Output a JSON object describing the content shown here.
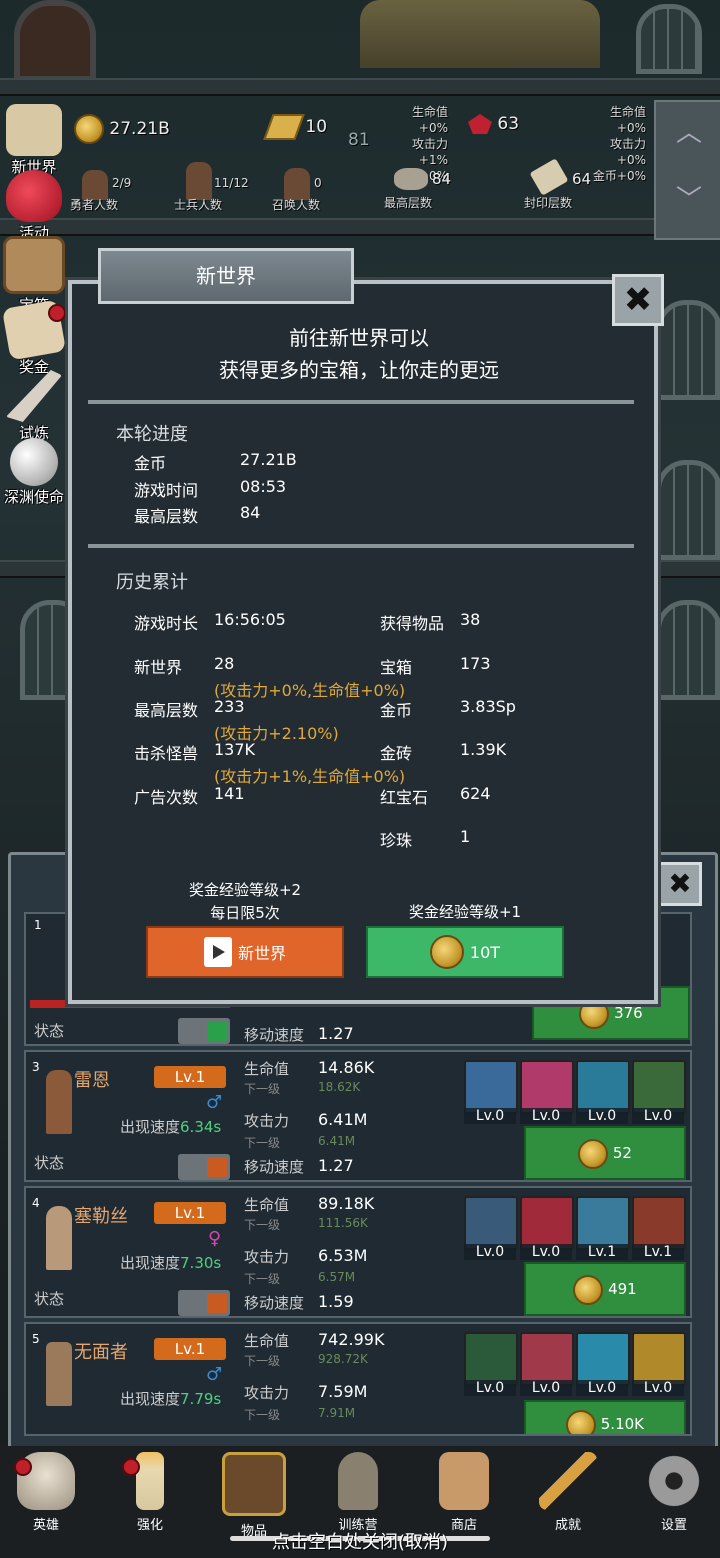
{
  "left_menu": [
    {
      "name": "left-menu-new-world",
      "label": "新世界",
      "icon": "scroll-icon"
    },
    {
      "name": "left-menu-events",
      "label": "活动",
      "icon": "heart-icon"
    },
    {
      "name": "left-menu-chest",
      "label": "宝箱",
      "icon": "chest-icon"
    },
    {
      "name": "left-menu-reward",
      "label": "奖金",
      "icon": "letter-icon"
    },
    {
      "name": "left-menu-trial",
      "label": "试炼",
      "icon": "feather-icon"
    },
    {
      "name": "left-menu-abyss",
      "label": "深渊使命",
      "icon": "pearl-icon"
    }
  ],
  "stats": {
    "gold": "27.21B",
    "gold_bar": "10",
    "floor_center": "81",
    "ruby": "63",
    "buff_mid": [
      "生命值+0%",
      "攻击力+1%",
      "金币+0%"
    ],
    "buff_right": [
      "生命值+0%",
      "攻击力+0%",
      "金币+0%"
    ],
    "heroes_value": "2/9",
    "heroes_label": "勇者人数",
    "soldiers_value": "11/12",
    "soldiers_label": "士兵人数",
    "summon_value": "0",
    "summon_label": "召唤人数",
    "max_floor_value": "84",
    "max_floor_label": "最高层数",
    "seal_value": "64",
    "seal_label": "封印层数"
  },
  "modal": {
    "title": "新世界",
    "intro1": "前往新世界可以",
    "intro2": "获得更多的宝箱，让你走的更远",
    "section1": "本轮进度",
    "round": [
      {
        "k": "金币",
        "v": "27.21B"
      },
      {
        "k": "游戏时间",
        "v": "08:53"
      },
      {
        "k": "最高层数",
        "v": "84"
      }
    ],
    "section2": "历史累计",
    "hist_left": [
      {
        "k": "游戏时长",
        "v": "16:56:05",
        "bonus": ""
      },
      {
        "k": "新世界",
        "v": "28",
        "bonus": "(攻击力+0%,生命值+0%)"
      },
      {
        "k": "最高层数",
        "v": "233",
        "bonus": "(攻击力+2.10%)"
      },
      {
        "k": "击杀怪兽",
        "v": "137K",
        "bonus": "(攻击力+1%,生命值+0%)"
      },
      {
        "k": "广告次数",
        "v": "141",
        "bonus": ""
      }
    ],
    "hist_right": [
      {
        "k": "获得物品",
        "v": "38"
      },
      {
        "k": "宝箱",
        "v": "173"
      },
      {
        "k": "金币",
        "v": "3.83Sp"
      },
      {
        "k": "金砖",
        "v": "1.39K"
      },
      {
        "k": "红宝石",
        "v": "624"
      },
      {
        "k": "珍珠",
        "v": "1"
      }
    ],
    "left_note1": "奖金经验等级+2",
    "left_note2": "每日限5次",
    "right_note": "奖金经验等级+1",
    "btn_left": "新世界",
    "btn_right": "10T"
  },
  "heroes_top": {
    "index": "1",
    "state_label": "状态",
    "next_label": "下一级",
    "move_label": "移动速度",
    "move_val": "1.27",
    "btn": "376"
  },
  "heroes": [
    {
      "index": "3",
      "name": "雷恩",
      "lv": "Lv.1",
      "appear_label": "出现速度",
      "appear": "6.34s",
      "hp": "14.86K",
      "hp_next": "18.62K",
      "atk": "6.41M",
      "atk_next": "6.41M",
      "move": "1.27",
      "skills": [
        "Lv.0",
        "Lv.0",
        "Lv.0",
        "Lv.0"
      ],
      "btn": "52"
    },
    {
      "index": "4",
      "name": "塞勒丝",
      "lv": "Lv.1",
      "appear_label": "出现速度",
      "appear": "7.30s",
      "hp": "89.18K",
      "hp_next": "111.56K",
      "atk": "6.53M",
      "atk_next": "6.57M",
      "move": "1.59",
      "skills": [
        "Lv.0",
        "Lv.0",
        "Lv.1",
        "Lv.1"
      ],
      "btn": "491"
    },
    {
      "index": "5",
      "name": "无面者",
      "lv": "Lv.1",
      "appear_label": "出现速度",
      "appear": "7.79s",
      "hp": "742.99K",
      "hp_next": "928.72K",
      "atk": "7.59M",
      "atk_next": "7.91M",
      "move": "",
      "skills": [
        "Lv.0",
        "Lv.0",
        "Lv.0",
        "Lv.0"
      ],
      "btn": "5.10K"
    }
  ],
  "labels": {
    "hp": "生命值",
    "next": "下一级",
    "atk": "攻击力",
    "move": "移动速度",
    "state": "状态"
  },
  "nav": [
    "英雄",
    "强化",
    "物品",
    "训练营",
    "商店",
    "成就",
    "设置"
  ],
  "bottom_hint": "点击空白处关闭(取消)",
  "colors": {
    "accent_orange": "#e0652a",
    "accent_green": "#3cb868",
    "bonus_gold": "#e0a93a",
    "name_orange": "#e6a56c"
  }
}
